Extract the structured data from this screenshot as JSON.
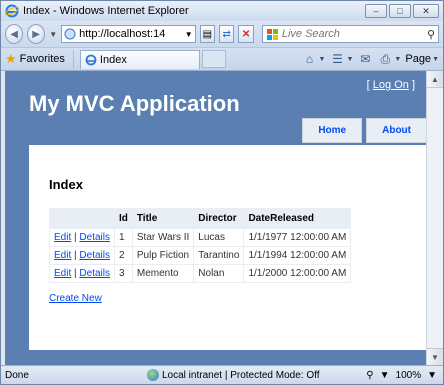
{
  "window": {
    "title": "Index - Windows Internet Explorer"
  },
  "window_buttons": {
    "minimize": "–",
    "maximize": "□",
    "close": "✕"
  },
  "navbar": {
    "address_url": "http://localhost:14",
    "search_placeholder": "Live Search"
  },
  "tabbar": {
    "favorites_label": "Favorites",
    "tab_label": "Index",
    "page_label": "Page"
  },
  "site": {
    "login_open": "[",
    "login_link": "Log On",
    "login_close": "]",
    "app_title": "My MVC Application",
    "menu": [
      {
        "label": "Home"
      },
      {
        "label": "About"
      }
    ],
    "heading": "Index",
    "table": {
      "headers": [
        "",
        "Id",
        "Title",
        "Director",
        "DateReleased"
      ],
      "edit_label": "Edit",
      "separator": "|",
      "details_label": "Details",
      "rows": [
        {
          "id": "1",
          "title": "Star Wars II",
          "director": "Lucas",
          "date": "1/1/1977 12:00:00 AM"
        },
        {
          "id": "2",
          "title": "Pulp Fiction",
          "director": "Tarantino",
          "date": "1/1/1994 12:00:00 AM"
        },
        {
          "id": "3",
          "title": "Memento",
          "director": "Nolan",
          "date": "1/1/2000 12:00:00 AM"
        }
      ]
    },
    "create_new": "Create New"
  },
  "statusbar": {
    "status": "Done",
    "zone": "Local intranet | Protected Mode: Off",
    "zoom": "100%"
  },
  "colors": {
    "site_background": "#5a7fb0",
    "link": "#034af3",
    "menu_tab": "#e8eef4"
  }
}
